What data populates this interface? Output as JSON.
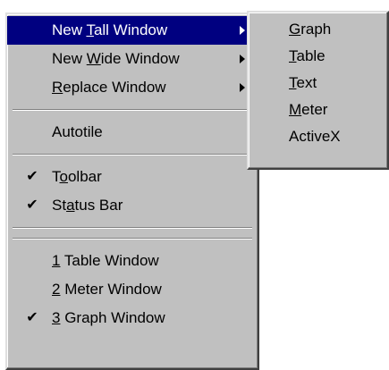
{
  "main_menu": {
    "items": [
      {
        "pre": "New ",
        "acc": "T",
        "post": "all Window",
        "check": "",
        "arrow": true
      },
      {
        "pre": "New ",
        "acc": "W",
        "post": "ide Window",
        "check": "",
        "arrow": true
      },
      {
        "pre": "",
        "acc": "R",
        "post": "eplace Window",
        "check": "",
        "arrow": true
      },
      {
        "pre": "Autotile",
        "acc": "",
        "post": "",
        "check": ""
      },
      {
        "pre": "T",
        "acc": "o",
        "post": "olbar",
        "check": "✔"
      },
      {
        "pre": "St",
        "acc": "a",
        "post": "tus Bar",
        "check": "✔"
      },
      {
        "pre": "",
        "acc": "1",
        "post": " Table  Window",
        "check": ""
      },
      {
        "pre": "",
        "acc": "2",
        "post": " Meter  Window",
        "check": ""
      },
      {
        "pre": "",
        "acc": "3",
        "post": " Graph Window",
        "check": "✔"
      }
    ]
  },
  "submenu": {
    "items": [
      {
        "acc": "G",
        "post": "raph"
      },
      {
        "acc": "T",
        "post": "able"
      },
      {
        "acc": "T",
        "post": "ext"
      },
      {
        "acc": "M",
        "post": "eter"
      },
      {
        "acc": "",
        "post": "ActiveX"
      }
    ]
  },
  "colors": {
    "menu_bg": "#c0c0c0",
    "highlight": "#000080",
    "highlight_text": "#ffffff"
  }
}
